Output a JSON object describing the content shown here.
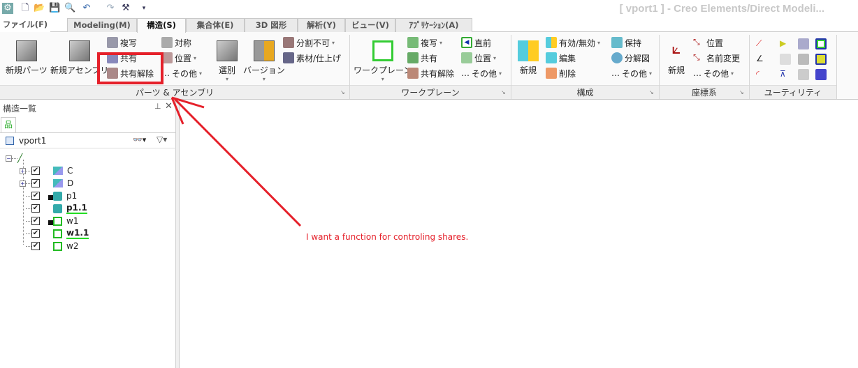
{
  "title": "[ vport1 ] - Creo Elements/Direct Modeli...",
  "tabs": [
    {
      "label": "ファイル(F)"
    },
    {
      "label": "Modeling(M)"
    },
    {
      "label": "構造(S)"
    },
    {
      "label": "集合体(E)"
    },
    {
      "label": "3D 図形"
    },
    {
      "label": "解析(Y)"
    },
    {
      "label": "ビュー(V)"
    },
    {
      "label": "ｱﾌﾟﾘｹｰｼｮﾝ(A)"
    }
  ],
  "groups": {
    "parts": {
      "label": "パーツ & アセンブリ",
      "new_part": "新規パーツ",
      "new_assembly": "新規アセンブリ",
      "copy": "複写",
      "share": "共有",
      "unshare": "共有解除",
      "mirror": "対称",
      "position": "位置",
      "other": "その他",
      "select": "選別",
      "version": "バージョン",
      "indivisible": "分割不可",
      "material": "素材/仕上げ"
    },
    "workplane": {
      "label": "ワークプレーン",
      "workplane": "ワークプレーン",
      "copy": "複写",
      "share": "共有",
      "unshare": "共有解除",
      "previous": "直前",
      "position": "位置",
      "other": "その他"
    },
    "config": {
      "label": "構成",
      "new": "新規",
      "toggle": "有効/無効",
      "edit": "編集",
      "delete": "削除",
      "keep": "保持",
      "explode": "分解図",
      "other": "その他"
    },
    "coord": {
      "label": "座標系",
      "new": "新規",
      "position": "位置",
      "rename": "名前変更",
      "other": "その他"
    },
    "utility": {
      "label": "ユーティリティ"
    }
  },
  "panel": {
    "title": "構造一覧",
    "root": "vport1",
    "items": [
      {
        "label": "C",
        "bold": false
      },
      {
        "label": "D",
        "bold": false
      },
      {
        "label": "p1",
        "bold": false
      },
      {
        "label": "p1.1",
        "bold": true
      },
      {
        "label": "w1",
        "bold": false
      },
      {
        "label": "w1.1",
        "bold": true
      },
      {
        "label": "w2",
        "bold": false
      }
    ]
  },
  "annotation": "I want a function for controling shares.",
  "colors": {
    "highlight": "#e5202a"
  }
}
